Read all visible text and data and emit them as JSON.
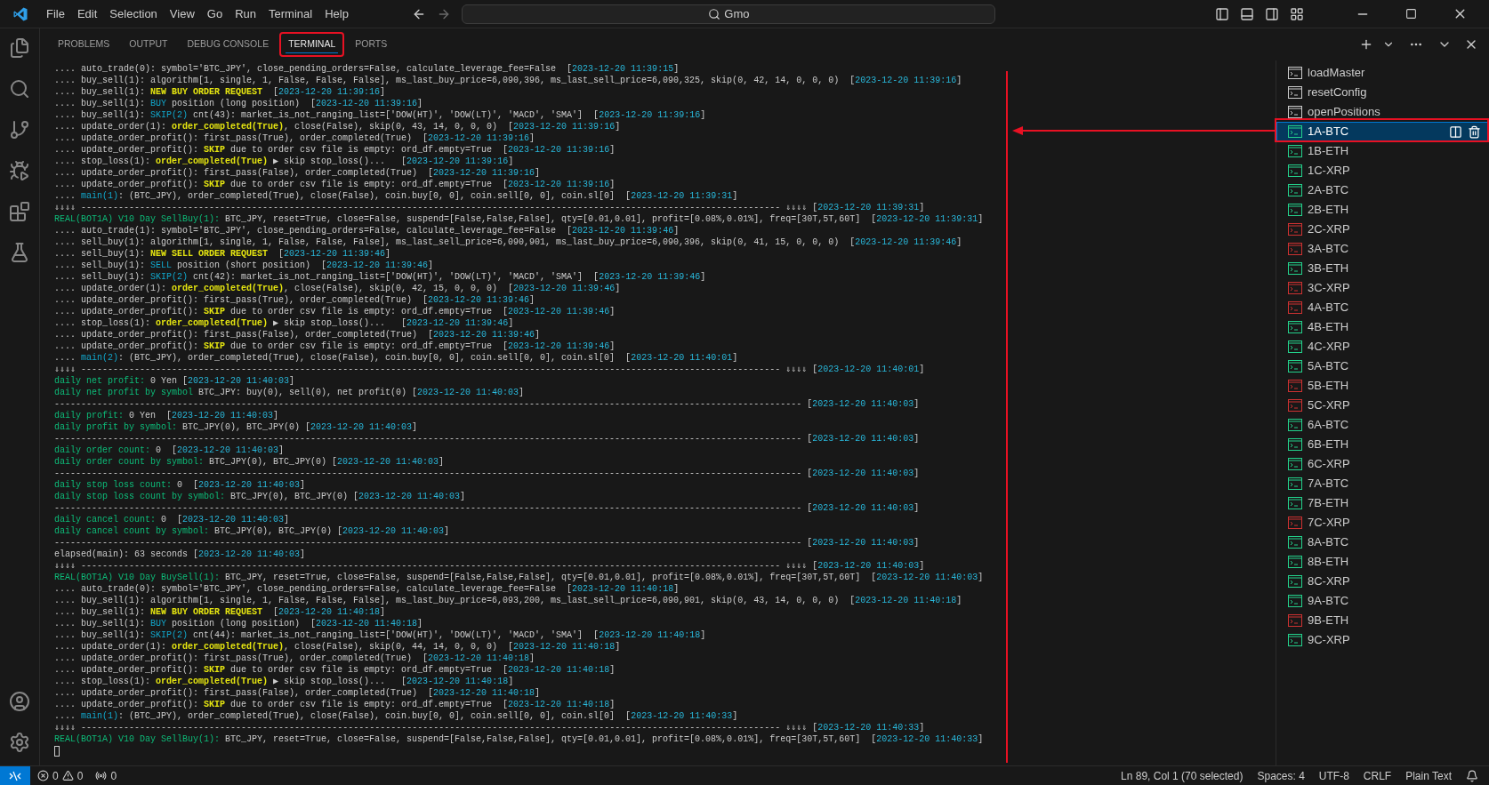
{
  "menu": [
    "File",
    "Edit",
    "Selection",
    "View",
    "Go",
    "Run",
    "Terminal",
    "Help"
  ],
  "command_center": {
    "value": "Gmo"
  },
  "panel": {
    "tabs": [
      {
        "label": "PROBLEMS",
        "selected": false
      },
      {
        "label": "OUTPUT",
        "selected": false
      },
      {
        "label": "DEBUG CONSOLE",
        "selected": false
      },
      {
        "label": "TERMINAL",
        "selected": true
      },
      {
        "label": "PORTS",
        "selected": false
      }
    ]
  },
  "terminal_lines": [
    [
      {
        "kind": "plain",
        "text": ".... auto_trade(0): symbol='BTC_JPY', close_pending_orders=False, calculate_leverage_fee=False  ["
      },
      {
        "kind": "time",
        "text": "2023-12-20 11:39:15"
      },
      {
        "kind": "plain",
        "text": "]"
      }
    ],
    [
      {
        "kind": "plain",
        "text": ".... buy_sell(1): algorithm[1, single, 1, False, False, False], ms_last_buy_price=6,090,396, ms_last_sell_price=6,090,325, skip(0, 42, 14, 0, 0, 0)  ["
      },
      {
        "kind": "time",
        "text": "2023-12-20 11:39:16"
      },
      {
        "kind": "plain",
        "text": "]"
      }
    ],
    [
      {
        "kind": "plain",
        "text": ".... buy_sell(1): "
      },
      {
        "kind": "warn",
        "text": "NEW BUY ORDER REQUEST"
      },
      {
        "kind": "plain",
        "text": "  ["
      },
      {
        "kind": "time",
        "text": "2023-12-20 11:39:16"
      },
      {
        "kind": "plain",
        "text": "]"
      }
    ],
    [
      {
        "kind": "plain",
        "text": ".... buy_sell(1): "
      },
      {
        "kind": "info",
        "text": "BUY"
      },
      {
        "kind": "plain",
        "text": " position (long position)  ["
      },
      {
        "kind": "time",
        "text": "2023-12-20 11:39:16"
      },
      {
        "kind": "plain",
        "text": "]"
      }
    ],
    [
      {
        "kind": "plain",
        "text": ".... buy_sell(1): "
      },
      {
        "kind": "info",
        "text": "SKIP(2)"
      },
      {
        "kind": "plain",
        "text": " cnt(43): market_is_not_ranging_list=['DOW(HT)', 'DOW(LT)', 'MACD', 'SMA']  ["
      },
      {
        "kind": "time",
        "text": "2023-12-20 11:39:16"
      },
      {
        "kind": "plain",
        "text": "]"
      }
    ],
    [
      {
        "kind": "plain",
        "text": ".... update_order(1): "
      },
      {
        "kind": "warn",
        "text": "order_completed(True)"
      },
      {
        "kind": "plain",
        "text": ", close(False), skip(0, 43, 14, 0, 0, 0)  ["
      },
      {
        "kind": "time",
        "text": "2023-12-20 11:39:16"
      },
      {
        "kind": "plain",
        "text": "]"
      }
    ],
    [
      {
        "kind": "plain",
        "text": ".... update_order_profit(): first_pass(True), order_completed(True)  ["
      },
      {
        "kind": "time",
        "text": "2023-12-20 11:39:16"
      },
      {
        "kind": "plain",
        "text": "]"
      }
    ],
    [
      {
        "kind": "plain",
        "text": ".... update_order_profit(): "
      },
      {
        "kind": "warn",
        "text": "SKIP"
      },
      {
        "kind": "plain",
        "text": " due to order csv file is empty: ord_df.empty=True  ["
      },
      {
        "kind": "time",
        "text": "2023-12-20 11:39:16"
      },
      {
        "kind": "plain",
        "text": "]"
      }
    ],
    [
      {
        "kind": "plain",
        "text": ".... stop_loss(1): "
      },
      {
        "kind": "warn",
        "text": "order_completed(True)"
      },
      {
        "kind": "plain",
        "text": " ▶ skip stop_loss()...   ["
      },
      {
        "kind": "time",
        "text": "2023-12-20 11:39:16"
      },
      {
        "kind": "plain",
        "text": "]"
      }
    ],
    [
      {
        "kind": "plain",
        "text": ".... update_order_profit(): first_pass(False), order_completed(True)  ["
      },
      {
        "kind": "time",
        "text": "2023-12-20 11:39:16"
      },
      {
        "kind": "plain",
        "text": "]"
      }
    ],
    [
      {
        "kind": "plain",
        "text": ".... update_order_profit(): "
      },
      {
        "kind": "warn",
        "text": "SKIP"
      },
      {
        "kind": "plain",
        "text": " due to order csv file is empty: ord_df.empty=True  ["
      },
      {
        "kind": "time",
        "text": "2023-12-20 11:39:16"
      },
      {
        "kind": "plain",
        "text": "]"
      }
    ],
    [
      {
        "kind": "plain",
        "text": ".... "
      },
      {
        "kind": "info",
        "text": "main(1)"
      },
      {
        "kind": "plain",
        "text": ": (BTC_JPY), order_completed(True), close(False), coin.buy[0, 0], coin.sell[0, 0], coin.sl[0]  ["
      },
      {
        "kind": "time",
        "text": "2023-12-20 11:39:31"
      },
      {
        "kind": "plain",
        "text": "]"
      }
    ],
    [
      {
        "kind": "plain",
        "text": "⇓⇓⇓⇓ ----------------------------------------------------------------------------------------------------------------------------------- ⇓⇓⇓⇓ ["
      },
      {
        "kind": "time",
        "text": "2023-12-20 11:39:31"
      },
      {
        "kind": "plain",
        "text": "]"
      }
    ],
    [
      {
        "kind": "good",
        "text": "REAL(BOT1A) V10 Day SellBuy(1):"
      },
      {
        "kind": "plain",
        "text": " BTC_JPY, reset=True, close=False, suspend=[False,False,False], qty=[0.01,0.01], profit=[0.08%,0.01%], freq=[30T,5T,60T]  ["
      },
      {
        "kind": "time",
        "text": "2023-12-20 11:39:31"
      },
      {
        "kind": "plain",
        "text": "]"
      }
    ],
    [
      {
        "kind": "plain",
        "text": ".... auto_trade(1): symbol='BTC_JPY', close_pending_orders=False, calculate_leverage_fee=False  ["
      },
      {
        "kind": "time",
        "text": "2023-12-20 11:39:46"
      },
      {
        "kind": "plain",
        "text": "]"
      }
    ],
    [
      {
        "kind": "plain",
        "text": ".... sell_buy(1): algorithm[1, single, 1, False, False, False], ms_last_sell_price=6,090,901, ms_last_buy_price=6,090,396, skip(0, 41, 15, 0, 0, 0)  ["
      },
      {
        "kind": "time",
        "text": "2023-12-20 11:39:46"
      },
      {
        "kind": "plain",
        "text": "]"
      }
    ],
    [
      {
        "kind": "plain",
        "text": ".... sell_buy(1): "
      },
      {
        "kind": "warn",
        "text": "NEW SELL ORDER REQUEST"
      },
      {
        "kind": "plain",
        "text": "  ["
      },
      {
        "kind": "time",
        "text": "2023-12-20 11:39:46"
      },
      {
        "kind": "plain",
        "text": "]"
      }
    ],
    [
      {
        "kind": "plain",
        "text": ".... sell_buy(1): "
      },
      {
        "kind": "info",
        "text": "SELL"
      },
      {
        "kind": "plain",
        "text": " position (short position)  ["
      },
      {
        "kind": "time",
        "text": "2023-12-20 11:39:46"
      },
      {
        "kind": "plain",
        "text": "]"
      }
    ],
    [
      {
        "kind": "plain",
        "text": ".... sell_buy(1): "
      },
      {
        "kind": "info",
        "text": "SKIP(2)"
      },
      {
        "kind": "plain",
        "text": " cnt(42): market_is_not_ranging_list=['DOW(HT)', 'DOW(LT)', 'MACD', 'SMA']  ["
      },
      {
        "kind": "time",
        "text": "2023-12-20 11:39:46"
      },
      {
        "kind": "plain",
        "text": "]"
      }
    ],
    [
      {
        "kind": "plain",
        "text": ".... update_order(1): "
      },
      {
        "kind": "warn",
        "text": "order_completed(True)"
      },
      {
        "kind": "plain",
        "text": ", close(False), skip(0, 42, 15, 0, 0, 0)  ["
      },
      {
        "kind": "time",
        "text": "2023-12-20 11:39:46"
      },
      {
        "kind": "plain",
        "text": "]"
      }
    ],
    [
      {
        "kind": "plain",
        "text": ".... update_order_profit(): first_pass(True), order_completed(True)  ["
      },
      {
        "kind": "time",
        "text": "2023-12-20 11:39:46"
      },
      {
        "kind": "plain",
        "text": "]"
      }
    ],
    [
      {
        "kind": "plain",
        "text": ".... update_order_profit(): "
      },
      {
        "kind": "warn",
        "text": "SKIP"
      },
      {
        "kind": "plain",
        "text": " due to order csv file is empty: ord_df.empty=True  ["
      },
      {
        "kind": "time",
        "text": "2023-12-20 11:39:46"
      },
      {
        "kind": "plain",
        "text": "]"
      }
    ],
    [
      {
        "kind": "plain",
        "text": ".... stop_loss(1): "
      },
      {
        "kind": "warn",
        "text": "order_completed(True)"
      },
      {
        "kind": "plain",
        "text": " ▶ skip stop_loss()...   ["
      },
      {
        "kind": "time",
        "text": "2023-12-20 11:39:46"
      },
      {
        "kind": "plain",
        "text": "]"
      }
    ],
    [
      {
        "kind": "plain",
        "text": ".... update_order_profit(): first_pass(False), order_completed(True)  ["
      },
      {
        "kind": "time",
        "text": "2023-12-20 11:39:46"
      },
      {
        "kind": "plain",
        "text": "]"
      }
    ],
    [
      {
        "kind": "plain",
        "text": ".... update_order_profit(): "
      },
      {
        "kind": "warn",
        "text": "SKIP"
      },
      {
        "kind": "plain",
        "text": " due to order csv file is empty: ord_df.empty=True  ["
      },
      {
        "kind": "time",
        "text": "2023-12-20 11:39:46"
      },
      {
        "kind": "plain",
        "text": "]"
      }
    ],
    [
      {
        "kind": "plain",
        "text": ".... "
      },
      {
        "kind": "info",
        "text": "main(2)"
      },
      {
        "kind": "plain",
        "text": ": (BTC_JPY), order_completed(True), close(False), coin.buy[0, 0], coin.sell[0, 0], coin.sl[0]  ["
      },
      {
        "kind": "time",
        "text": "2023-12-20 11:40:01"
      },
      {
        "kind": "plain",
        "text": "]"
      }
    ],
    [
      {
        "kind": "plain",
        "text": "⇓⇓⇓⇓ ----------------------------------------------------------------------------------------------------------------------------------- ⇓⇓⇓⇓ ["
      },
      {
        "kind": "time",
        "text": "2023-12-20 11:40:01"
      },
      {
        "kind": "plain",
        "text": "]"
      }
    ],
    [
      {
        "kind": "good",
        "text": "daily net profit:"
      },
      {
        "kind": "plain",
        "text": " 0 Yen ["
      },
      {
        "kind": "time",
        "text": "2023-12-20 11:40:03"
      },
      {
        "kind": "plain",
        "text": "]"
      }
    ],
    [
      {
        "kind": "good",
        "text": "daily net profit by symbol"
      },
      {
        "kind": "plain",
        "text": " BTC_JPY: buy(0), sell(0), net profit(0) ["
      },
      {
        "kind": "time",
        "text": "2023-12-20 11:40:03"
      },
      {
        "kind": "plain",
        "text": "]"
      }
    ],
    [
      {
        "kind": "plain",
        "text": "-------------------------------------------------------------------------------------------------------------------------------------------- ["
      },
      {
        "kind": "time",
        "text": "2023-12-20 11:40:03"
      },
      {
        "kind": "plain",
        "text": "]"
      }
    ],
    [
      {
        "kind": "good",
        "text": "daily profit:"
      },
      {
        "kind": "plain",
        "text": " 0 Yen  ["
      },
      {
        "kind": "time",
        "text": "2023-12-20 11:40:03"
      },
      {
        "kind": "plain",
        "text": "]"
      }
    ],
    [
      {
        "kind": "good",
        "text": "daily profit by symbol:"
      },
      {
        "kind": "plain",
        "text": " BTC_JPY(0), BTC_JPY(0) ["
      },
      {
        "kind": "time",
        "text": "2023-12-20 11:40:03"
      },
      {
        "kind": "plain",
        "text": "]"
      }
    ],
    [
      {
        "kind": "plain",
        "text": "-------------------------------------------------------------------------------------------------------------------------------------------- ["
      },
      {
        "kind": "time",
        "text": "2023-12-20 11:40:03"
      },
      {
        "kind": "plain",
        "text": "]"
      }
    ],
    [
      {
        "kind": "good",
        "text": "daily order count:"
      },
      {
        "kind": "plain",
        "text": " 0  ["
      },
      {
        "kind": "time",
        "text": "2023-12-20 11:40:03"
      },
      {
        "kind": "plain",
        "text": "]"
      }
    ],
    [
      {
        "kind": "good",
        "text": "daily order count by symbol:"
      },
      {
        "kind": "plain",
        "text": " BTC_JPY(0), BTC_JPY(0) ["
      },
      {
        "kind": "time",
        "text": "2023-12-20 11:40:03"
      },
      {
        "kind": "plain",
        "text": "]"
      }
    ],
    [
      {
        "kind": "plain",
        "text": "-------------------------------------------------------------------------------------------------------------------------------------------- ["
      },
      {
        "kind": "time",
        "text": "2023-12-20 11:40:03"
      },
      {
        "kind": "plain",
        "text": "]"
      }
    ],
    [
      {
        "kind": "good",
        "text": "daily stop loss count:"
      },
      {
        "kind": "plain",
        "text": " 0  ["
      },
      {
        "kind": "time",
        "text": "2023-12-20 11:40:03"
      },
      {
        "kind": "plain",
        "text": "]"
      }
    ],
    [
      {
        "kind": "good",
        "text": "daily stop loss count by symbol:"
      },
      {
        "kind": "plain",
        "text": " BTC_JPY(0), BTC_JPY(0) ["
      },
      {
        "kind": "time",
        "text": "2023-12-20 11:40:03"
      },
      {
        "kind": "plain",
        "text": "]"
      }
    ],
    [
      {
        "kind": "plain",
        "text": "-------------------------------------------------------------------------------------------------------------------------------------------- ["
      },
      {
        "kind": "time",
        "text": "2023-12-20 11:40:03"
      },
      {
        "kind": "plain",
        "text": "]"
      }
    ],
    [
      {
        "kind": "good",
        "text": "daily cancel count:"
      },
      {
        "kind": "plain",
        "text": " 0  ["
      },
      {
        "kind": "time",
        "text": "2023-12-20 11:40:03"
      },
      {
        "kind": "plain",
        "text": "]"
      }
    ],
    [
      {
        "kind": "good",
        "text": "daily cancel count by symbol:"
      },
      {
        "kind": "plain",
        "text": " BTC_JPY(0), BTC_JPY(0) ["
      },
      {
        "kind": "time",
        "text": "2023-12-20 11:40:03"
      },
      {
        "kind": "plain",
        "text": "]"
      }
    ],
    [
      {
        "kind": "plain",
        "text": "-------------------------------------------------------------------------------------------------------------------------------------------- ["
      },
      {
        "kind": "time",
        "text": "2023-12-20 11:40:03"
      },
      {
        "kind": "plain",
        "text": "]"
      }
    ],
    [
      {
        "kind": "plain",
        "text": "elapsed(main): 63 seconds ["
      },
      {
        "kind": "time",
        "text": "2023-12-20 11:40:03"
      },
      {
        "kind": "plain",
        "text": "]"
      }
    ],
    [
      {
        "kind": "plain",
        "text": "⇓⇓⇓⇓ ----------------------------------------------------------------------------------------------------------------------------------- ⇓⇓⇓⇓ ["
      },
      {
        "kind": "time",
        "text": "2023-12-20 11:40:03"
      },
      {
        "kind": "plain",
        "text": "]"
      }
    ],
    [
      {
        "kind": "good",
        "text": "REAL(BOT1A) V10 Day BuySell(1):"
      },
      {
        "kind": "plain",
        "text": " BTC_JPY, reset=True, close=False, suspend=[False,False,False], qty=[0.01,0.01], profit=[0.08%,0.01%], freq=[30T,5T,60T]  ["
      },
      {
        "kind": "time",
        "text": "2023-12-20 11:40:03"
      },
      {
        "kind": "plain",
        "text": "]"
      }
    ],
    [
      {
        "kind": "plain",
        "text": ".... auto_trade(0): symbol='BTC_JPY', close_pending_orders=False, calculate_leverage_fee=False  ["
      },
      {
        "kind": "time",
        "text": "2023-12-20 11:40:18"
      },
      {
        "kind": "plain",
        "text": "]"
      }
    ],
    [
      {
        "kind": "plain",
        "text": ".... buy_sell(1): algorithm[1, single, 1, False, False, False], ms_last_buy_price=6,093,200, ms_last_sell_price=6,090,901, skip(0, 43, 14, 0, 0, 0)  ["
      },
      {
        "kind": "time",
        "text": "2023-12-20 11:40:18"
      },
      {
        "kind": "plain",
        "text": "]"
      }
    ],
    [
      {
        "kind": "plain",
        "text": ".... buy_sell(1): "
      },
      {
        "kind": "warn",
        "text": "NEW BUY ORDER REQUEST"
      },
      {
        "kind": "plain",
        "text": "  ["
      },
      {
        "kind": "time",
        "text": "2023-12-20 11:40:18"
      },
      {
        "kind": "plain",
        "text": "]"
      }
    ],
    [
      {
        "kind": "plain",
        "text": ".... buy_sell(1): "
      },
      {
        "kind": "info",
        "text": "BUY"
      },
      {
        "kind": "plain",
        "text": " position (long position)  ["
      },
      {
        "kind": "time",
        "text": "2023-12-20 11:40:18"
      },
      {
        "kind": "plain",
        "text": "]"
      }
    ],
    [
      {
        "kind": "plain",
        "text": ".... buy_sell(1): "
      },
      {
        "kind": "info",
        "text": "SKIP(2)"
      },
      {
        "kind": "plain",
        "text": " cnt(44): market_is_not_ranging_list=['DOW(HT)', 'DOW(LT)', 'MACD', 'SMA']  ["
      },
      {
        "kind": "time",
        "text": "2023-12-20 11:40:18"
      },
      {
        "kind": "plain",
        "text": "]"
      }
    ],
    [
      {
        "kind": "plain",
        "text": ".... update_order(1): "
      },
      {
        "kind": "warn",
        "text": "order_completed(True)"
      },
      {
        "kind": "plain",
        "text": ", close(False), skip(0, 44, 14, 0, 0, 0)  ["
      },
      {
        "kind": "time",
        "text": "2023-12-20 11:40:18"
      },
      {
        "kind": "plain",
        "text": "]"
      }
    ],
    [
      {
        "kind": "plain",
        "text": ".... update_order_profit(): first_pass(True), order_completed(True)  ["
      },
      {
        "kind": "time",
        "text": "2023-12-20 11:40:18"
      },
      {
        "kind": "plain",
        "text": "]"
      }
    ],
    [
      {
        "kind": "plain",
        "text": ".... update_order_profit(): "
      },
      {
        "kind": "warn",
        "text": "SKIP"
      },
      {
        "kind": "plain",
        "text": " due to order csv file is empty: ord_df.empty=True  ["
      },
      {
        "kind": "time",
        "text": "2023-12-20 11:40:18"
      },
      {
        "kind": "plain",
        "text": "]"
      }
    ],
    [
      {
        "kind": "plain",
        "text": ".... stop_loss(1): "
      },
      {
        "kind": "warn",
        "text": "order_completed(True)"
      },
      {
        "kind": "plain",
        "text": " ▶ skip stop_loss()...   ["
      },
      {
        "kind": "time",
        "text": "2023-12-20 11:40:18"
      },
      {
        "kind": "plain",
        "text": "]"
      }
    ],
    [
      {
        "kind": "plain",
        "text": ".... update_order_profit(): first_pass(False), order_completed(True)  ["
      },
      {
        "kind": "time",
        "text": "2023-12-20 11:40:18"
      },
      {
        "kind": "plain",
        "text": "]"
      }
    ],
    [
      {
        "kind": "plain",
        "text": ".... update_order_profit(): "
      },
      {
        "kind": "warn",
        "text": "SKIP"
      },
      {
        "kind": "plain",
        "text": " due to order csv file is empty: ord_df.empty=True  ["
      },
      {
        "kind": "time",
        "text": "2023-12-20 11:40:18"
      },
      {
        "kind": "plain",
        "text": "]"
      }
    ],
    [
      {
        "kind": "plain",
        "text": ".... "
      },
      {
        "kind": "info",
        "text": "main(1)"
      },
      {
        "kind": "plain",
        "text": ": (BTC_JPY), order_completed(True), close(False), coin.buy[0, 0], coin.sell[0, 0], coin.sl[0]  ["
      },
      {
        "kind": "time",
        "text": "2023-12-20 11:40:33"
      },
      {
        "kind": "plain",
        "text": "]"
      }
    ],
    [
      {
        "kind": "plain",
        "text": "⇓⇓⇓⇓ ----------------------------------------------------------------------------------------------------------------------------------- ⇓⇓⇓⇓ ["
      },
      {
        "kind": "time",
        "text": "2023-12-20 11:40:33"
      },
      {
        "kind": "plain",
        "text": "]"
      }
    ],
    [
      {
        "kind": "good",
        "text": "REAL(BOT1A) V10 Day SellBuy(1):"
      },
      {
        "kind": "plain",
        "text": " BTC_JPY, reset=True, close=False, suspend=[False,False,False], qty=[0.01,0.01], profit=[0.08%,0.01%], freq=[30T,5T,60T]  ["
      },
      {
        "kind": "time",
        "text": "2023-12-20 11:40:33"
      },
      {
        "kind": "plain",
        "text": "]"
      }
    ]
  ],
  "terminals": [
    {
      "name": "loadMaster",
      "color": "#cccccc",
      "selected": false
    },
    {
      "name": "resetConfig",
      "color": "#cccccc",
      "selected": false
    },
    {
      "name": "openPositions",
      "color": "#cccccc",
      "selected": false
    },
    {
      "name": "1A-BTC",
      "color": "#23d18b",
      "selected": true
    },
    {
      "name": "1B-ETH",
      "color": "#23d18b",
      "selected": false
    },
    {
      "name": "1C-XRP",
      "color": "#23d18b",
      "selected": false
    },
    {
      "name": "2A-BTC",
      "color": "#23d18b",
      "selected": false
    },
    {
      "name": "2B-ETH",
      "color": "#23d18b",
      "selected": false
    },
    {
      "name": "2C-XRP",
      "color": "#cd3131",
      "selected": false
    },
    {
      "name": "3A-BTC",
      "color": "#cd3131",
      "selected": false
    },
    {
      "name": "3B-ETH",
      "color": "#23d18b",
      "selected": false
    },
    {
      "name": "3C-XRP",
      "color": "#cd3131",
      "selected": false
    },
    {
      "name": "4A-BTC",
      "color": "#cd3131",
      "selected": false
    },
    {
      "name": "4B-ETH",
      "color": "#23d18b",
      "selected": false
    },
    {
      "name": "4C-XRP",
      "color": "#23d18b",
      "selected": false
    },
    {
      "name": "5A-BTC",
      "color": "#23d18b",
      "selected": false
    },
    {
      "name": "5B-ETH",
      "color": "#cd3131",
      "selected": false
    },
    {
      "name": "5C-XRP",
      "color": "#cd3131",
      "selected": false
    },
    {
      "name": "6A-BTC",
      "color": "#23d18b",
      "selected": false
    },
    {
      "name": "6B-ETH",
      "color": "#23d18b",
      "selected": false
    },
    {
      "name": "6C-XRP",
      "color": "#23d18b",
      "selected": false
    },
    {
      "name": "7A-BTC",
      "color": "#23d18b",
      "selected": false
    },
    {
      "name": "7B-ETH",
      "color": "#23d18b",
      "selected": false
    },
    {
      "name": "7C-XRP",
      "color": "#cd3131",
      "selected": false
    },
    {
      "name": "8A-BTC",
      "color": "#23d18b",
      "selected": false
    },
    {
      "name": "8B-ETH",
      "color": "#23d18b",
      "selected": false
    },
    {
      "name": "8C-XRP",
      "color": "#23d18b",
      "selected": false
    },
    {
      "name": "9A-BTC",
      "color": "#23d18b",
      "selected": false
    },
    {
      "name": "9B-ETH",
      "color": "#cd3131",
      "selected": false
    },
    {
      "name": "9C-XRP",
      "color": "#23d18b",
      "selected": false
    }
  ],
  "status_bar": {
    "errors": "0",
    "warnings": "0",
    "ports": "0",
    "items": [
      "Ln 89, Col 1 (70 selected)",
      "Spaces: 4",
      "UTF-8",
      "CRLF",
      "Plain Text"
    ]
  }
}
